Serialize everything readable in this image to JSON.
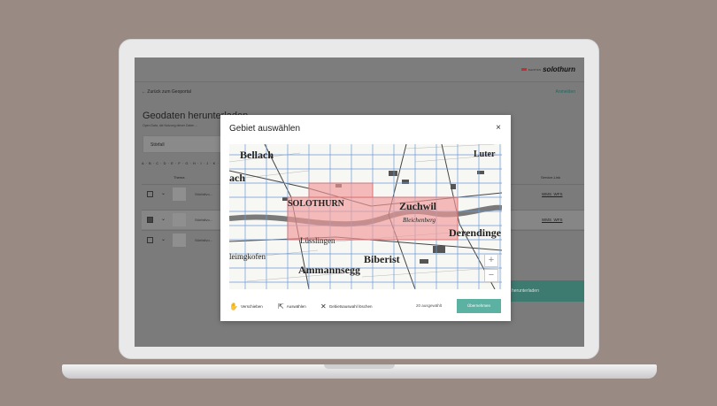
{
  "header": {
    "kanton": "KANTON",
    "brand": "solothurn",
    "back_link": "← Zurück zum Geoportal",
    "login": "Anmelden"
  },
  "page": {
    "title": "Geodaten herunterladen",
    "subtitle": "Open Data, die Nutzung dieser Daten ...",
    "filter_value": "Störfall",
    "alphabet": "A · B · C · D · E · F · G · H · I · J · K · L · M",
    "col_thema": "Thema",
    "col_service": "Service-Link",
    "rows": [
      {
        "label": "Störfallvo...",
        "checked": false,
        "wms": "WMS",
        "wfs": "WFS"
      },
      {
        "label": "Störfallvo...",
        "checked": true,
        "wms": "WMS",
        "wfs": "WFS"
      },
      {
        "label": "Störfallvo...",
        "checked": false
      }
    ],
    "download_button": "herunterladen"
  },
  "modal": {
    "title": "Gebiet auswählen",
    "close": "×",
    "zoom_in": "+",
    "zoom_out": "−",
    "tools": {
      "move": "Verschieben",
      "select": "Auswählen",
      "clear": "Gebietsauswahl löschen"
    },
    "count": "20 ausgewählt",
    "apply": "Übernehmen"
  },
  "map_labels": {
    "bellach": "Bellach",
    "ach": "ach",
    "solothurn": "SOLOTHURN",
    "zuchwil": "Zuchwil",
    "luesslingen": "Lüsslingen",
    "biberist": "Biberist",
    "ammannsegg": "Ammannsegg",
    "derendingen": "Derendinge",
    "luterbach": "Luter",
    "bleichenberg": "Bleichenberg",
    "leimgkofen": "leimgkofen"
  },
  "colors": {
    "accent": "#5bb2a2",
    "selection": "#f19a9a"
  }
}
